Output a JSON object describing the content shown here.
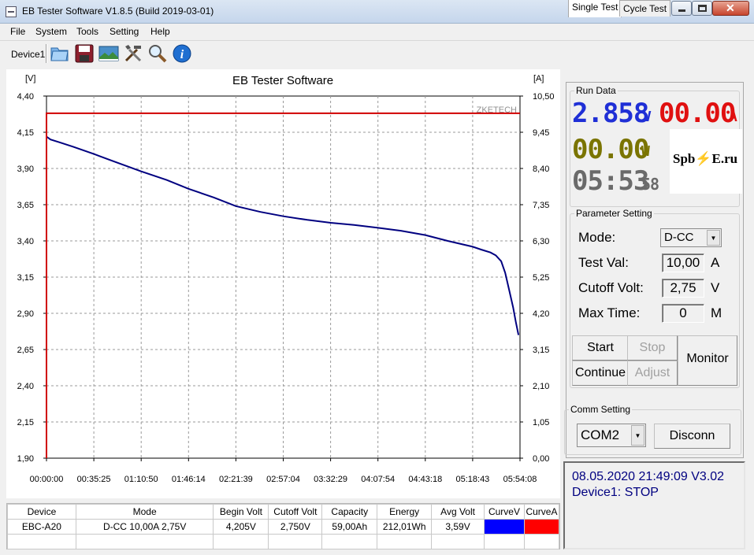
{
  "window": {
    "title": "EB Tester Software V1.8.5 (Build 2019-03-01)",
    "close_glyph": "✕"
  },
  "menu": [
    "File",
    "System",
    "Tools",
    "Setting",
    "Help"
  ],
  "toolbar": {
    "device_label": "Device1",
    "tools": [
      "open-folder-icon",
      "save-disk-icon",
      "picture-icon",
      "tools-icon",
      "search-icon",
      "info-icon"
    ]
  },
  "chart_data": {
    "type": "line",
    "title": "EB Tester Software",
    "watermark": "ZKETECH",
    "y_left_unit": "[V]",
    "y_right_unit": "[A]",
    "y_left_ticks": [
      "4,40",
      "4,15",
      "3,90",
      "3,65",
      "3,40",
      "3,15",
      "2,90",
      "2,65",
      "2,40",
      "2,15",
      "1,90"
    ],
    "y_right_ticks": [
      "10,50",
      "9,45",
      "8,40",
      "7,35",
      "6,30",
      "5,25",
      "4,20",
      "3,15",
      "2,10",
      "1,05",
      "0,00"
    ],
    "x_ticks": [
      "00:00:00",
      "00:35:25",
      "01:10:50",
      "01:46:14",
      "02:21:39",
      "02:57:04",
      "03:32:29",
      "04:07:54",
      "04:43:18",
      "05:18:43",
      "05:54:08"
    ],
    "ylim_left": [
      1.9,
      4.4
    ],
    "ylim_right": [
      0,
      10.5
    ],
    "xlim_minutes": [
      0,
      354.1
    ],
    "grid": true,
    "series": [
      {
        "name": "CurveV",
        "axis": "left",
        "color": "#000080",
        "x_minutes": [
          0,
          3,
          10,
          20,
          35.4,
          50,
          70.8,
          90,
          106.2,
          125,
          141.6,
          160,
          177.1,
          195,
          212.5,
          230,
          247.9,
          265,
          283.3,
          300,
          318.7,
          325,
          332,
          336,
          340,
          343,
          346,
          349,
          351,
          353
        ],
        "values": [
          4.12,
          4.1,
          4.08,
          4.05,
          4.0,
          3.95,
          3.88,
          3.82,
          3.76,
          3.7,
          3.64,
          3.6,
          3.57,
          3.545,
          3.525,
          3.51,
          3.49,
          3.47,
          3.44,
          3.4,
          3.36,
          3.34,
          3.32,
          3.3,
          3.26,
          3.18,
          3.06,
          2.94,
          2.84,
          2.75
        ]
      },
      {
        "name": "CurveA",
        "axis": "right",
        "color": "#d00000",
        "x_minutes": [
          0,
          0,
          354.1
        ],
        "values": [
          0,
          10.0,
          10.0
        ]
      }
    ]
  },
  "results": {
    "headers": [
      "Device",
      "Mode",
      "Begin Volt",
      "Cutoff Volt",
      "Capacity",
      "Energy",
      "Avg Volt",
      "CurveV",
      "CurveA"
    ],
    "row": [
      "EBC-A20",
      "D-CC  10,00A  2,75V",
      "4,205V",
      "2,750V",
      "59,00Ah",
      "212,01Wh",
      "3,59V",
      "",
      ""
    ],
    "curve_colors": [
      "#0000ff",
      "#ff0000"
    ]
  },
  "tabs": [
    "Single Test",
    "Cycle Test"
  ],
  "run_data": {
    "title": "Run Data",
    "voltage": "2.858",
    "voltage_unit": "V",
    "current": "00.00",
    "current_unit": "A",
    "power": "00.00",
    "power_unit": "W",
    "time": "05:53",
    "time_seconds": "58",
    "logo_text": "Spb⚡E.ru"
  },
  "params": {
    "title": "Parameter Setting",
    "mode_label": "Mode:",
    "mode_value": "D-CC",
    "test_val_label": "Test Val:",
    "test_val": "10,00",
    "test_val_unit": "A",
    "cutoff_label": "Cutoff Volt:",
    "cutoff_val": "2,75",
    "cutoff_unit": "V",
    "maxtime_label": "Max Time:",
    "maxtime_val": "0",
    "maxtime_unit": "M"
  },
  "buttons": {
    "start": "Start",
    "stop": "Stop",
    "continue": "Continue",
    "adjust": "Adjust",
    "monitor": "Monitor"
  },
  "comm": {
    "title": "Comm Setting",
    "port": "COM2",
    "disconnect": "Disconn"
  },
  "status": {
    "line1": "08.05.2020 21:49:09  V3.02",
    "line2": "Device1: STOP"
  }
}
